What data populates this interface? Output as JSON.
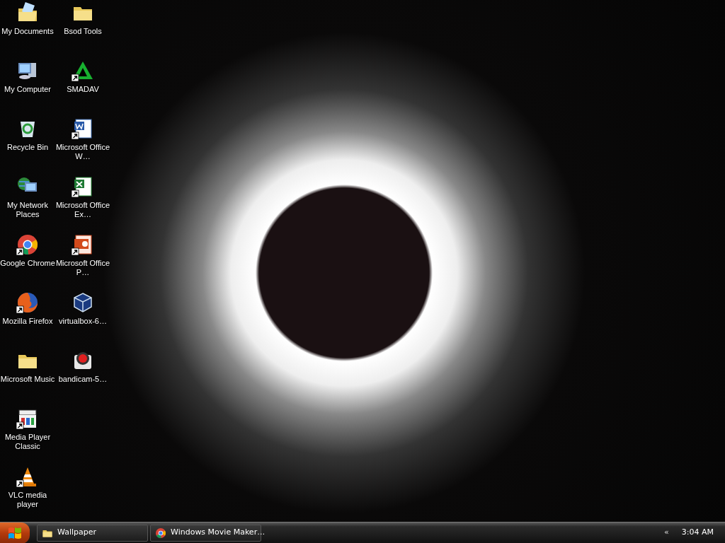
{
  "desktop": {
    "icons": [
      {
        "label": "My Documents",
        "kind": "documents",
        "shortcut": false
      },
      {
        "label": "My Computer",
        "kind": "computer",
        "shortcut": false
      },
      {
        "label": "Recycle Bin",
        "kind": "recycle",
        "shortcut": false
      },
      {
        "label": "My Network Places",
        "kind": "network",
        "shortcut": false
      },
      {
        "label": "Google Chrome",
        "kind": "chrome",
        "shortcut": true
      },
      {
        "label": "Mozilla Firefox",
        "kind": "firefox",
        "shortcut": true
      },
      {
        "label": "Microsoft Music",
        "kind": "folder",
        "shortcut": false
      },
      {
        "label": "Media Player Classic",
        "kind": "mpc",
        "shortcut": true
      },
      {
        "label": "VLC media player",
        "kind": "vlc",
        "shortcut": true
      },
      {
        "label": "Bsod Tools",
        "kind": "folder",
        "shortcut": false
      },
      {
        "label": "SMADAV",
        "kind": "smadav",
        "shortcut": true
      },
      {
        "label": "Microsoft Office W…",
        "kind": "word",
        "shortcut": true
      },
      {
        "label": "Microsoft Office Ex…",
        "kind": "excel",
        "shortcut": true
      },
      {
        "label": "Microsoft Office P…",
        "kind": "powerpoint",
        "shortcut": true
      },
      {
        "label": "virtualbox-6…",
        "kind": "virtualbox",
        "shortcut": false
      },
      {
        "label": "bandicam-5…",
        "kind": "bandicam",
        "shortcut": false
      }
    ]
  },
  "taskbar": {
    "tasks": [
      {
        "label": "Wallpaper",
        "kind": "folder"
      },
      {
        "label": "Windows Movie Maker…",
        "kind": "chrome"
      }
    ],
    "tray_toggle": "«",
    "clock": "3:04 AM"
  }
}
